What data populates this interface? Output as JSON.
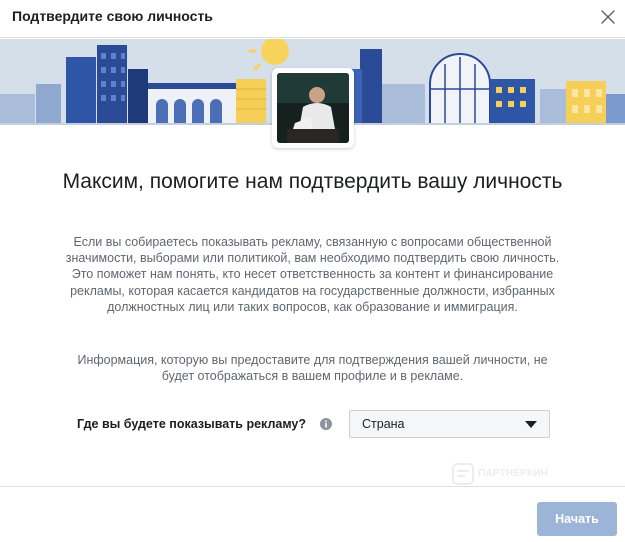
{
  "dialog": {
    "title": "Подтвердите свою личность",
    "close_icon": "close-icon"
  },
  "banner": {
    "illustration": "city-skyline-illustration",
    "colors": {
      "sky": "#d3dde8",
      "building_blue": "#2d4c8f",
      "building_yellow": "#f5c84a",
      "building_light": "#7b9bcf"
    }
  },
  "profile": {
    "avatar_icon": "profile-photo"
  },
  "main": {
    "heading": "Максим, помогите нам подтвердить вашу личность",
    "paragraph_1": "Если вы собираетесь показывать рекламу, связанную с вопросами общественной значимости, выборами или политикой, вам необходимо подтвердить свою личность. Это поможет нам понять, кто несет ответственность за контент и финансирование рекламы, которая касается кандидатов на государственные должности, избранных должностных лиц или таких вопросов, как образование и иммиграция.",
    "paragraph_2": "Информация, которую вы предоставите для подтверждения вашей личности, не будет отображаться в вашем профиле и в рекламе."
  },
  "question": {
    "label": "Где вы будете показывать рекламу?",
    "info_icon": "info-icon",
    "select_value": "Страна"
  },
  "watermark": {
    "text": "ПАРТНЕРКИН"
  },
  "footer": {
    "start_label": "Начать",
    "start_color": "#9cb4d8"
  }
}
